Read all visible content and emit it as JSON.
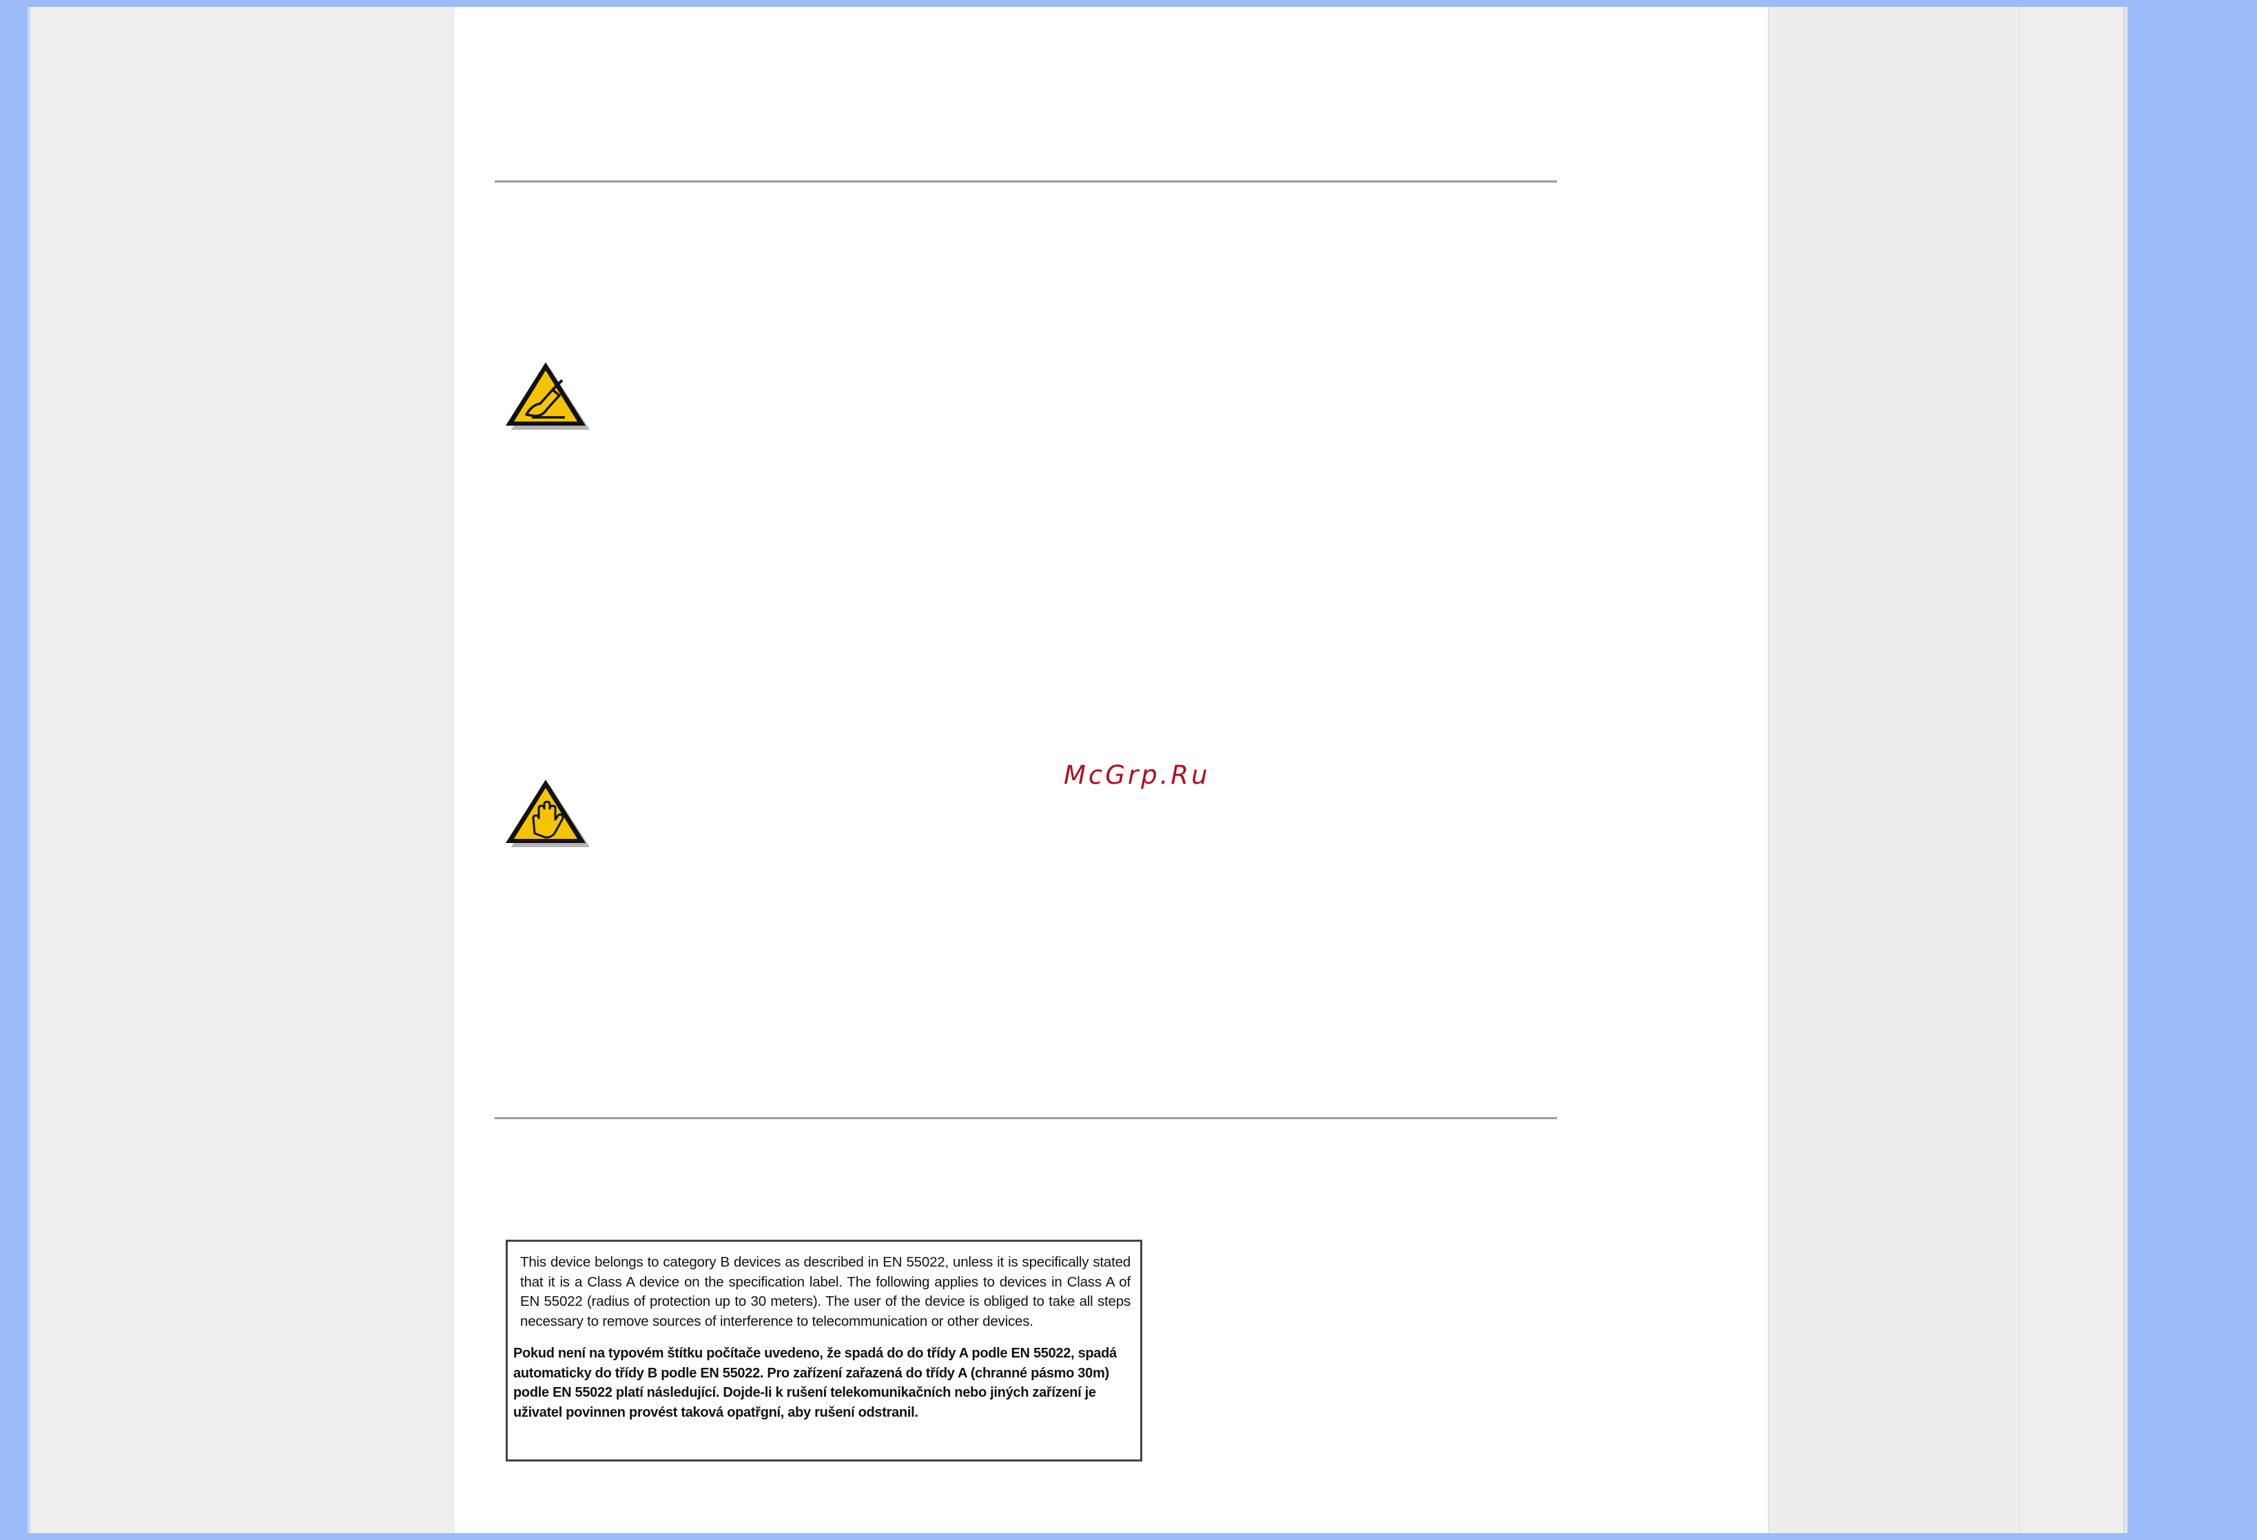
{
  "watermark": {
    "text": "McGrp.Ru"
  },
  "icons": {
    "note": "note-warning-icon",
    "caution": "caution-hand-icon"
  },
  "notice": {
    "english": "This device belongs to category B devices as described in EN 55022, unless it is specifically stated that it is a Class A device on the specification label. The following applies to devices in Class A of EN 55022 (radius of protection up to 30 meters). The user of the device is obliged to take all steps necessary to remove sources of interference to telecommunication or other devices.",
    "czech": "Pokud není na typovém štítku počítače uvedeno, že spadá do do třídy A podle EN 55022, spadá automaticky do třídy B podle EN 55022. Pro zařízení zařazená do třídy A (chranné pásmo 30m) podle EN 55022 platí následující. Dojde-li k rušení telekomunikačních nebo jiných zařízení  je uživatel povinnen provést taková opatřgní, aby rušení odstranil."
  },
  "colors": {
    "desktop": "#9bbcf8",
    "page": "#ffffff",
    "watermark": "#b0101c",
    "icon_fill": "#f5c400"
  }
}
